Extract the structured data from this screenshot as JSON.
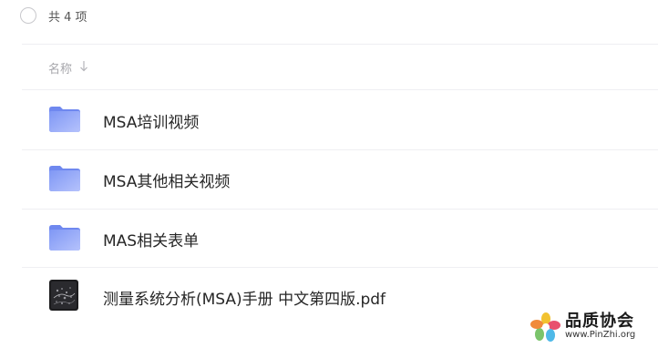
{
  "header": {
    "count_label": "共 4 项"
  },
  "columns": {
    "name_label": "名称"
  },
  "files": [
    {
      "name": "MSA培训视频",
      "type": "folder",
      "icon": "folder-icon"
    },
    {
      "name": "MSA其他相关视频",
      "type": "folder",
      "icon": "folder-icon"
    },
    {
      "name": "MAS相关表单",
      "type": "folder",
      "icon": "folder-icon"
    },
    {
      "name": "测量系统分析(MSA)手册 中文第四版.pdf",
      "type": "pdf",
      "icon": "pdf-thumbnail-icon"
    }
  ],
  "watermark": {
    "title": "品质协会",
    "url": "www.PinZhi.org"
  },
  "colors": {
    "folder_top": "#7f97f5",
    "folder_bottom": "#a9b8fb",
    "divider": "#efeff2",
    "text_primary": "#262626",
    "text_muted": "#a6a6ab"
  }
}
